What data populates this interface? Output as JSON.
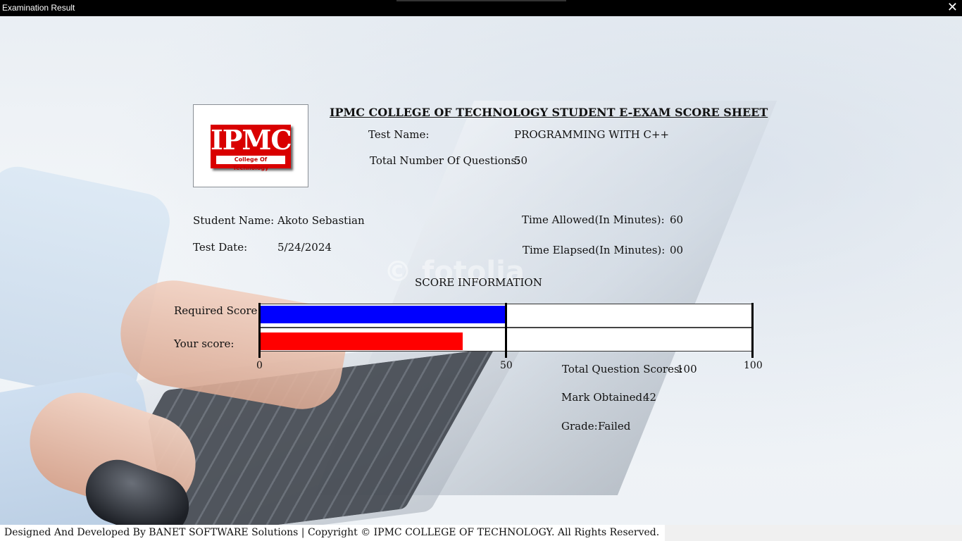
{
  "window": {
    "title": "Examination Result",
    "close_glyph": "✕"
  },
  "background": {
    "watermark": "© fotolia"
  },
  "logo": {
    "main": "IPMC",
    "sub": "College Of Technology"
  },
  "sheet": {
    "heading": "IPMC COLLEGE OF TECHNOLOGY STUDENT E-EXAM SCORE SHEET",
    "test_name_label": "Test Name:",
    "test_name_value": "PROGRAMMING WITH C++",
    "total_questions_label": "Total Number Of Questions:",
    "total_questions_value": "50",
    "student_name_label": "Student Name:",
    "student_name_value": "Akoto Sebastian",
    "test_date_label": "Test Date:",
    "test_date_value": "5/24/2024",
    "time_allowed_label": "Time Allowed(In Minutes):",
    "time_allowed_value": "60",
    "time_elapsed_label": "Time Elapsed(In Minutes):",
    "time_elapsed_value": "00"
  },
  "score": {
    "section_title": "SCORE INFORMATION",
    "required_label": "Required Score:",
    "your_label": "Your score:",
    "total_scores_label": "Total Question Scores:",
    "total_scores_value": "100",
    "mark_label": "Mark Obtained:",
    "mark_value": "42",
    "grade_label": "Grade:",
    "grade_value": "Failed"
  },
  "chart_data": {
    "type": "bar",
    "orientation": "horizontal",
    "categories": [
      "Required Score:",
      "Your score:"
    ],
    "values": [
      50,
      42
    ],
    "colors": [
      "#0000ff",
      "#ff0000"
    ],
    "xlim": [
      0,
      100
    ],
    "ticks": [
      "0",
      "50",
      "100"
    ]
  },
  "footer": {
    "text": "Designed And Developed By BANET SOFTWARE Solutions | Copyright © IPMC COLLEGE OF TECHNOLOGY. All Rights Reserved."
  }
}
